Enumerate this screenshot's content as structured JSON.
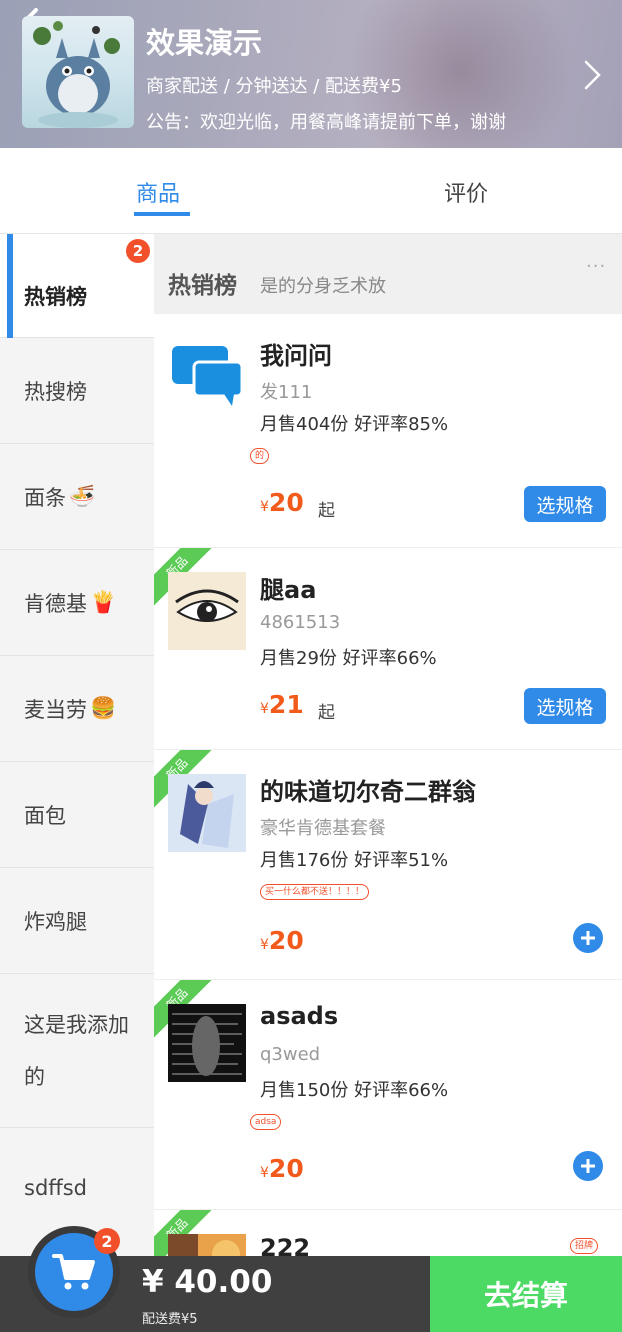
{
  "shop": {
    "name": "效果演示",
    "delivery": "商家配送 / 分钟送达 / 配送费¥5",
    "notice": "公告：欢迎光临，用餐高峰请提前下单，谢谢"
  },
  "tabs": [
    {
      "label": "商品",
      "active": true
    },
    {
      "label": "评价",
      "active": false
    }
  ],
  "sidebar": {
    "items": [
      {
        "label": "热销榜",
        "badge": "2",
        "active": true
      },
      {
        "label": "热搜榜"
      },
      {
        "label": "面条",
        "emoji": "🍜"
      },
      {
        "label": "肯德基",
        "emoji": "🍟"
      },
      {
        "label": "麦当劳",
        "emoji": "🍔"
      },
      {
        "label": "面包"
      },
      {
        "label": "炸鸡腿"
      },
      {
        "label_line1": "这是我添加",
        "label_line2": "的"
      },
      {
        "label": "sdffsd"
      }
    ]
  },
  "section": {
    "title": "热销榜",
    "desc": "是的分身乏术放",
    "more": "···"
  },
  "products": [
    {
      "name": "我问问",
      "desc": "发111",
      "stats": "月售404份  好评率85%",
      "tag": "的",
      "currency": "¥",
      "price": "20",
      "qi": "起",
      "action": "选规格",
      "is_new": false
    },
    {
      "name": "腿aa",
      "desc": "4861513",
      "stats": "月售29份  好评率66%",
      "currency": "¥",
      "price": "21",
      "qi": "起",
      "action": "选规格",
      "is_new": true,
      "new_label": "新品"
    },
    {
      "name": "的味道切尔奇二群翁",
      "desc": "豪华肯德基套餐",
      "stats": "月售176份  好评率51%",
      "tag": "买一什么都不送！！！！",
      "currency": "¥",
      "price": "20",
      "is_new": true,
      "new_label": "新品"
    },
    {
      "name": "asads",
      "desc": "q3wed",
      "stats": "月售150份  好评率66%",
      "tag": "adsa",
      "currency": "¥",
      "price": "20",
      "is_new": true,
      "new_label": "新品"
    },
    {
      "name": "222",
      "tag": "招牌",
      "is_new": true,
      "new_label": "新品"
    }
  ],
  "cart": {
    "count": "2",
    "total": "¥ 40.00",
    "delivery_fee": "配送费¥5",
    "checkout_label": "去结算"
  },
  "colors": {
    "accent": "#2f8ae8",
    "price": "#f25a1c",
    "badge": "#f2502b",
    "checkout": "#4cd964",
    "new_ribbon": "#5ccb56"
  }
}
